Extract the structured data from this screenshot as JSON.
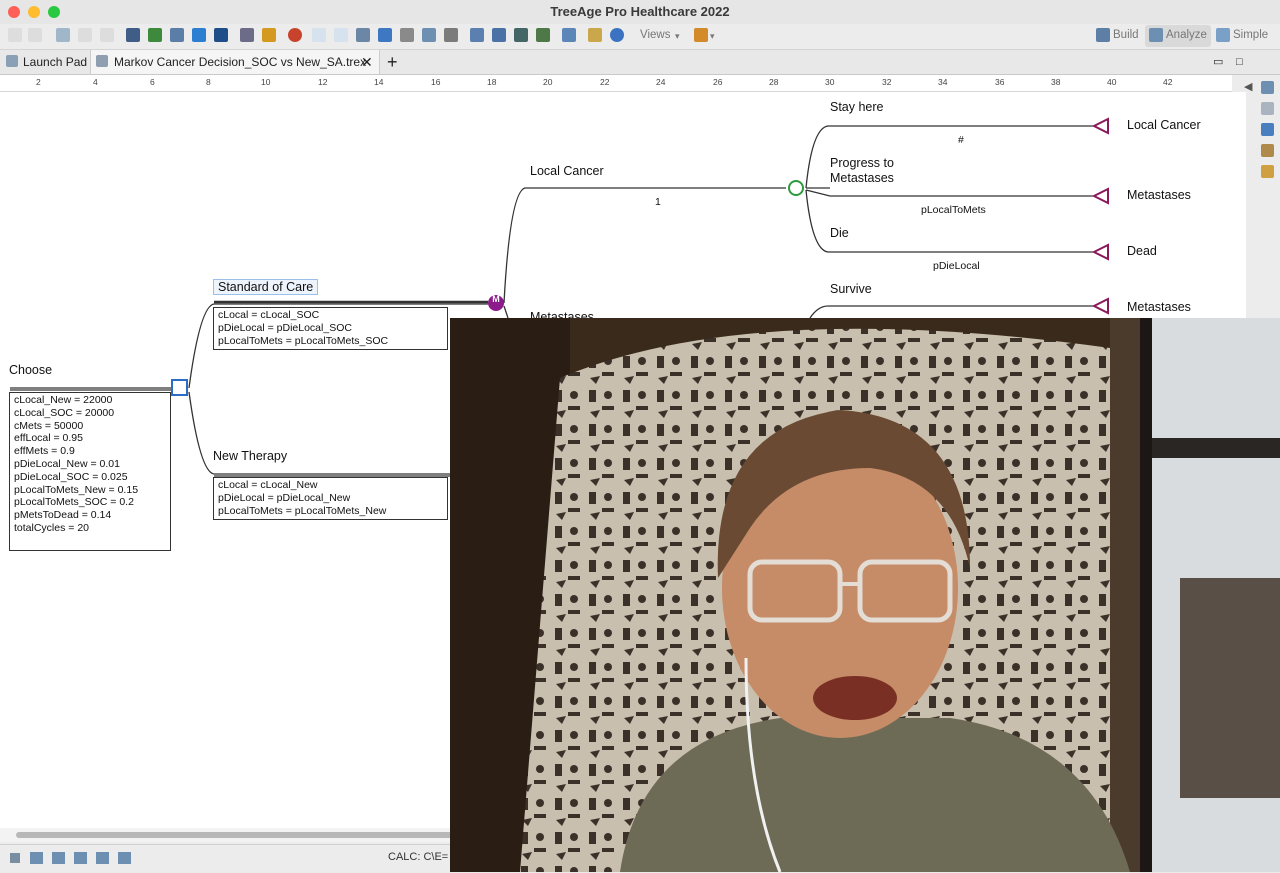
{
  "window": {
    "title": "TreeAge Pro Healthcare 2022"
  },
  "toolbar": {
    "views_label": "Views",
    "build_label": "Build",
    "analyze_label": "Analyze",
    "simple_label": "Simple"
  },
  "tabs": [
    {
      "label": "Launch Pad"
    },
    {
      "label": "Markov Cancer Decision_SOC vs New_SA.trex"
    }
  ],
  "ruler": {
    "ticks": [
      "2",
      "4",
      "6",
      "8",
      "10",
      "12",
      "14",
      "16",
      "18",
      "20",
      "22",
      "24",
      "26",
      "28",
      "30",
      "32",
      "34",
      "36",
      "38",
      "40",
      "42"
    ]
  },
  "tree": {
    "root": {
      "label": "Choose",
      "definitions": [
        "cLocal_New = 22000",
        "cLocal_SOC = 20000",
        "cMets = 50000",
        "effLocal = 0.95",
        "effMets = 0.9",
        "pDieLocal_New = 0.01",
        "pDieLocal_SOC = 0.025",
        "pLocalToMets_New = 0.15",
        "pLocalToMets_SOC = 0.2",
        "pMetsToDead = 0.14",
        "totalCycles = 20"
      ]
    },
    "soc": {
      "label": "Standard of Care",
      "markov_marker": "M",
      "definitions": [
        "cLocal = cLocal_SOC",
        "pDieLocal = pDieLocal_SOC",
        "pLocalToMets = pLocalToMets_SOC"
      ]
    },
    "new": {
      "label": "New Therapy",
      "definitions": [
        "cLocal = cLocal_New",
        "pDieLocal = pDieLocal_New",
        "pLocalToMets = pLocalToMets_New"
      ]
    },
    "local_cancer": {
      "label": "Local Cancer",
      "prob": "1"
    },
    "metastases_partial": {
      "label": "Metastases"
    },
    "branches": [
      {
        "label": "Stay here",
        "prob": "#",
        "terminal": "Local Cancer"
      },
      {
        "label": "Progress to Metastases",
        "prob": "pLocalToMets",
        "terminal": "Metastases"
      },
      {
        "label": "Die",
        "prob": "pDieLocal",
        "terminal": "Dead"
      },
      {
        "label": "Survive",
        "terminal": "Metastases"
      }
    ]
  },
  "status": {
    "calc_text": "CALC: C\\E="
  },
  "colors": {
    "accent": "#8b1a5a",
    "chance_node": "#2e9a3c",
    "decision_node": "#2b6cc4"
  }
}
